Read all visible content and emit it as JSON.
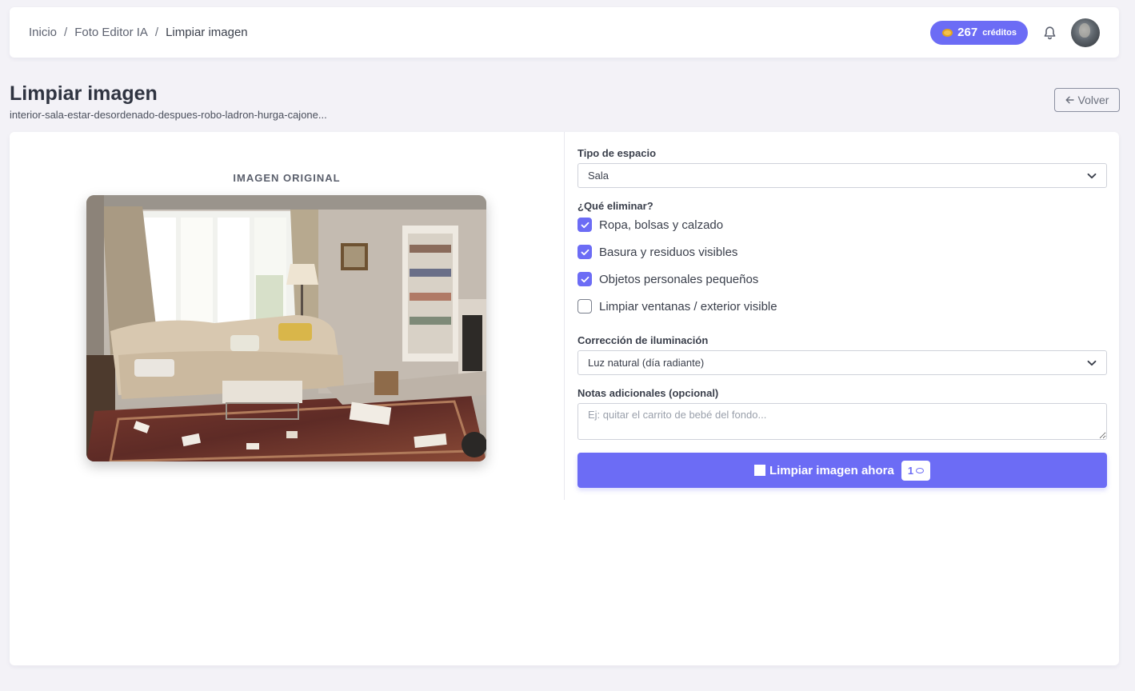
{
  "breadcrumb": {
    "items": [
      "Inicio",
      "Foto Editor IA",
      "Limpiar imagen"
    ],
    "separator": "/"
  },
  "header": {
    "credits_count": "267",
    "credits_label": "créditos",
    "notification_icon": "bell-icon",
    "avatar": "user-avatar"
  },
  "page": {
    "title": "Limpiar imagen",
    "file_name": "interior-sala-estar-desordenado-despues-robo-ladron-hurga-cajone...",
    "back_label": "Volver",
    "back_icon": "arrow-left-icon"
  },
  "preview": {
    "label": "IMAGEN ORIGINAL",
    "image_alt": "living room photo"
  },
  "form": {
    "space_type_label": "Tipo de espacio",
    "space_type_value": "Sala",
    "remove_label": "¿Qué eliminar?",
    "remove_options": [
      {
        "label": "Ropa, bolsas y calzado",
        "checked": true
      },
      {
        "label": "Basura y residuos visibles",
        "checked": true
      },
      {
        "label": "Objetos personales pequeños",
        "checked": true
      },
      {
        "label": "Limpiar ventanas / exterior visible",
        "checked": false
      }
    ],
    "lighting_label": "Corrección de iluminación",
    "lighting_value": "Luz natural (día radiante)",
    "notes_label": "Notas adicionales (opcional)",
    "notes_placeholder": "Ej: quitar el carrito de bebé del fondo...",
    "notes_value": "",
    "submit_label": "Limpiar imagen ahora",
    "submit_cost": "1"
  },
  "colors": {
    "accent": "#6c6cf5",
    "background": "#f3f2f7",
    "card": "#ffffff"
  }
}
